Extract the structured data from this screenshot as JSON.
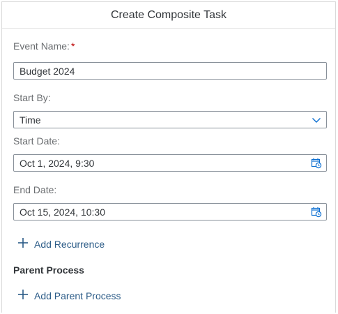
{
  "dialog": {
    "title": "Create Composite Task"
  },
  "event_name": {
    "label": "Event Name:",
    "required_mark": "*",
    "value": "Budget 2024"
  },
  "start_by": {
    "label": "Start By:",
    "selected": "Time"
  },
  "start_date": {
    "label": "Start Date:",
    "value": "Oct 1, 2024, 9:30"
  },
  "end_date": {
    "label": "End Date:",
    "value": "Oct 15, 2024, 10:30"
  },
  "recurrence": {
    "add_label": "Add Recurrence"
  },
  "parent_process": {
    "title": "Parent Process",
    "add_label": "Add Parent Process"
  },
  "colors": {
    "accent": "#0a6ed1",
    "link_text": "#2b5b87",
    "required": "#bb0000",
    "border": "#89919a",
    "label": "#6a6d70"
  },
  "icons": {
    "plus": "plus-icon",
    "calendar": "calendar-clock-icon",
    "dropdown": "chevron-down-icon"
  }
}
